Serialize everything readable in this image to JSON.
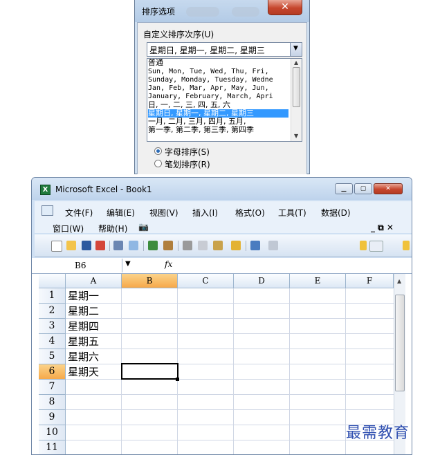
{
  "sort_dialog": {
    "title": "排序选项",
    "close_label": "✕",
    "custom_order_label": "自定义排序次序(U)",
    "combo_value": "星期日, 星期一, 星期二, 星期三",
    "list_items": [
      "普通",
      "Sun, Mon, Tue, Wed, Thu, Fri,",
      "Sunday, Monday, Tuesday, Wedne",
      "Jan, Feb, Mar, Apr, May, Jun,",
      "January, February, March, Apri",
      "日, 一, 二, 三, 四, 五, 六",
      "星期日, 星期一, 星期二, 星期三",
      "一月, 二月, 三月, 四月, 五月,",
      "第一季, 第二季, 第三季, 第四季"
    ],
    "selected_index": 6,
    "radio_letter": "字母排序(S)",
    "radio_stroke": "笔划排序(R)",
    "selected_radio": "letter"
  },
  "excel": {
    "title": "Microsoft Excel - Book1",
    "menu_row1": [
      "文件(F)",
      "编辑(E)",
      "视图(V)",
      "插入(I)",
      "格式(O)",
      "工具(T)",
      "数据(D)"
    ],
    "menu_row2": [
      "窗口(W)",
      "帮助(H)"
    ],
    "doc_controls": "_ ⧉ ✕",
    "name_box": "B6",
    "fx_label": "fx",
    "columns": [
      "A",
      "B",
      "C",
      "D",
      "E",
      "F"
    ],
    "rows": [
      "1",
      "2",
      "3",
      "4",
      "5",
      "6",
      "7",
      "8",
      "9",
      "10",
      "11"
    ],
    "cells_a": [
      "星期一",
      "星期二",
      "星期四",
      "星期五",
      "星期六",
      "星期天"
    ],
    "active_cell": "B6"
  },
  "watermark": "最需教育",
  "colors": {
    "selection": "#3399ff",
    "header_active": "#f6a94a",
    "title_gradient": "#bed3ec"
  }
}
